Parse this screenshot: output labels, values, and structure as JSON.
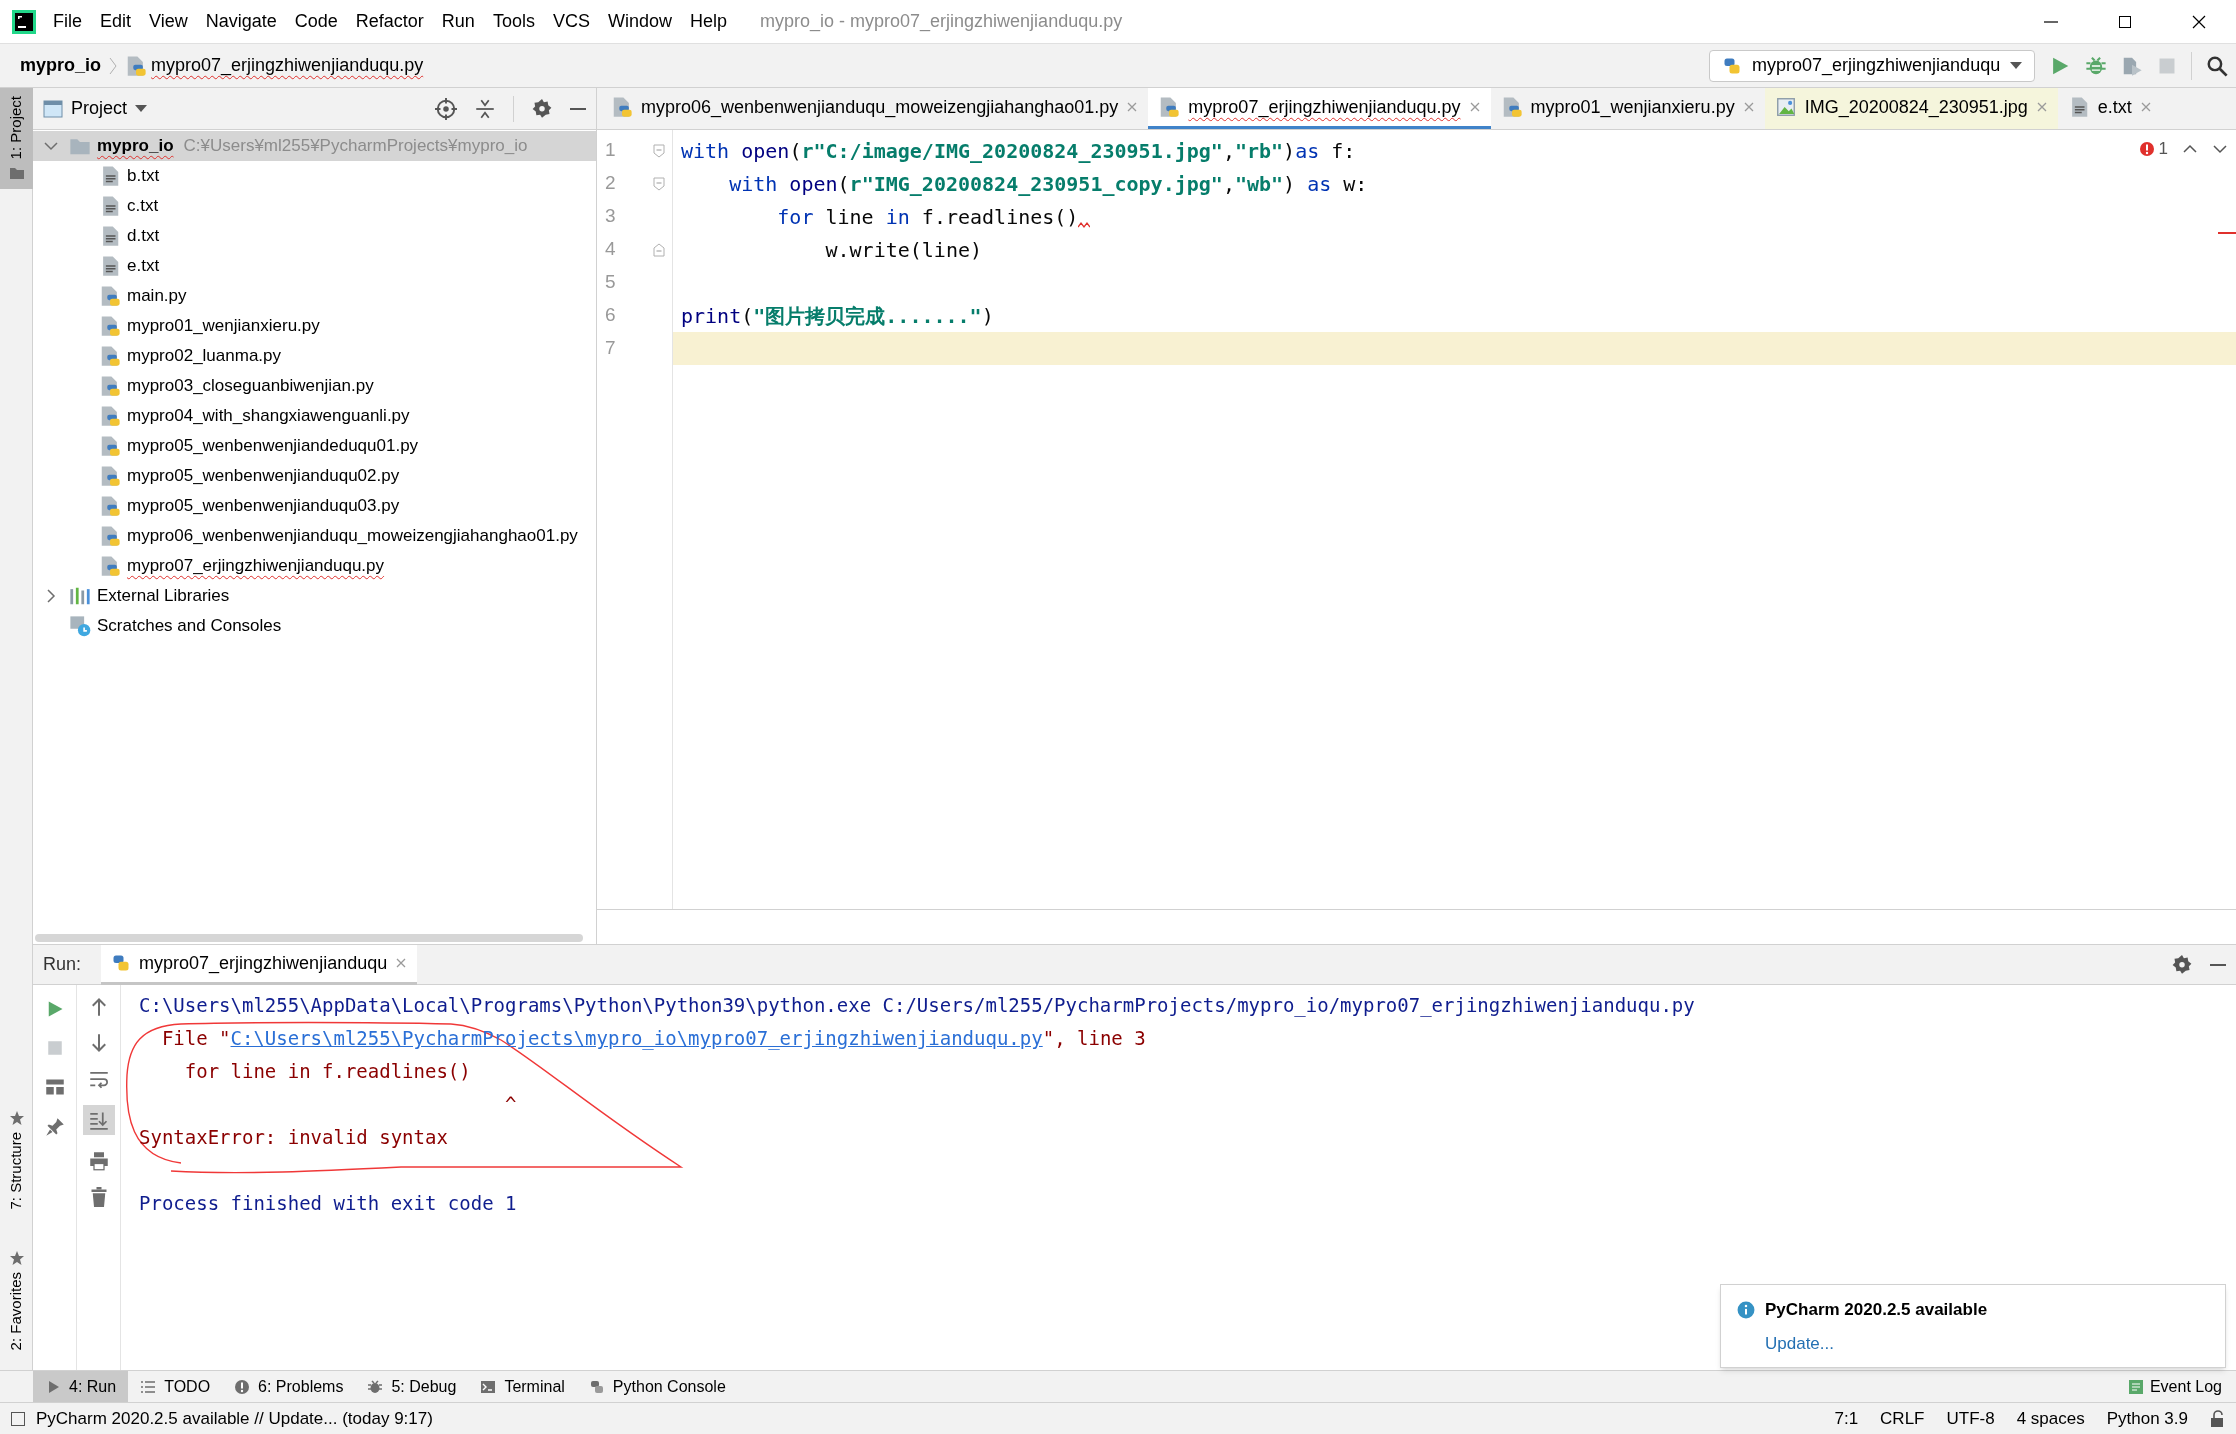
{
  "window": {
    "title": "mypro_io - mypro07_erjingzhiwenjianduqu.py"
  },
  "menu": [
    "File",
    "Edit",
    "View",
    "Navigate",
    "Code",
    "Refactor",
    "Run",
    "Tools",
    "VCS",
    "Window",
    "Help"
  ],
  "navbar": {
    "breadcrumbs": [
      {
        "label": "mypro_io",
        "error": false
      },
      {
        "label": "mypro07_erjingzhiwenjianduqu.py",
        "kind": "python",
        "error": true
      }
    ],
    "run_config": "mypro07_erjingzhiwenjianduqu"
  },
  "left_stripe": [
    {
      "label": "1: Project",
      "selected": true,
      "kind": "top"
    },
    {
      "label": "7: Structure",
      "selected": false,
      "kind": "bottom"
    },
    {
      "label": "2: Favorites",
      "selected": false,
      "kind": "bottom"
    }
  ],
  "project_panel": {
    "title": "Project",
    "tree": [
      {
        "label": "mypro_io",
        "path": "C:¥Users¥ml255¥PycharmProjects¥mypro_io",
        "kind": "folder",
        "expanded": true,
        "selected": true,
        "error": true,
        "children": [
          {
            "label": "b.txt",
            "kind": "text",
            "selected": false,
            "error": false
          },
          {
            "label": "c.txt",
            "kind": "text",
            "selected": false,
            "error": false
          },
          {
            "label": "d.txt",
            "kind": "text",
            "selected": false,
            "error": false
          },
          {
            "label": "e.txt",
            "kind": "text",
            "selected": false,
            "error": false
          },
          {
            "label": "main.py",
            "kind": "python",
            "selected": false,
            "error": false
          },
          {
            "label": "mypro01_wenjianxieru.py",
            "kind": "python",
            "selected": false,
            "error": false
          },
          {
            "label": "mypro02_luanma.py",
            "kind": "python",
            "selected": false,
            "error": false
          },
          {
            "label": "mypro03_closeguanbiwenjian.py",
            "kind": "python",
            "selected": false,
            "error": false
          },
          {
            "label": "mypro04_with_shangxiawenguanli.py",
            "kind": "python",
            "selected": false,
            "error": false
          },
          {
            "label": "mypro05_wenbenwenjiandeduqu01.py",
            "kind": "python",
            "selected": false,
            "error": false
          },
          {
            "label": "mypro05_wenbenwenjianduqu02.py",
            "kind": "python",
            "selected": false,
            "error": false
          },
          {
            "label": "mypro05_wenbenwenjianduqu03.py",
            "kind": "python",
            "selected": false,
            "error": false
          },
          {
            "label": "mypro06_wenbenwenjianduqu_moweizengjiahanghao01.py",
            "kind": "python",
            "selected": false,
            "error": false
          },
          {
            "label": "mypro07_erjingzhiwenjianduqu.py",
            "kind": "python",
            "selected": false,
            "error": true
          }
        ]
      },
      {
        "label": "External Libraries",
        "kind": "library",
        "expanded": false,
        "selected": false,
        "error": false
      },
      {
        "label": "Scratches and Consoles",
        "kind": "scratches",
        "selected": false,
        "error": false
      }
    ]
  },
  "editor_tabs": [
    {
      "label": "mypro06_wenbenwenjianduqu_moweizengjiahanghao01.py",
      "kind": "python",
      "selected": false,
      "error": false
    },
    {
      "label": "mypro07_erjingzhiwenjianduqu.py",
      "kind": "python",
      "selected": true,
      "error": true
    },
    {
      "label": "mypro01_wenjianxieru.py",
      "kind": "python",
      "selected": false,
      "error": false
    },
    {
      "label": "IMG_20200824_230951.jpg",
      "kind": "image",
      "selected": false,
      "error": false
    },
    {
      "label": "e.txt",
      "kind": "text",
      "selected": false,
      "error": false
    }
  ],
  "editor": {
    "problems": "1",
    "lines": [
      {
        "number": "1",
        "kind": "fold_start",
        "current": false,
        "error": false,
        "tokens": [
          {
            "kind": "keyword",
            "text": "with"
          },
          {
            "kind": "builtin",
            "text": " open"
          },
          {
            "kind": "plain",
            "text": "("
          },
          {
            "kind": "string",
            "text": "r\"C:/image/IMG_20200824_230951.jpg\""
          },
          {
            "kind": "plain",
            "text": ","
          },
          {
            "kind": "string",
            "text": "\"rb\""
          },
          {
            "kind": "plain",
            "text": ")"
          },
          {
            "kind": "keyword",
            "text": "as"
          },
          {
            "kind": "plain",
            "text": " f:"
          }
        ]
      },
      {
        "number": "2",
        "kind": "fold_start",
        "current": false,
        "error": false,
        "tokens": [
          {
            "kind": "keyword",
            "text": "    with"
          },
          {
            "kind": "builtin",
            "text": " open"
          },
          {
            "kind": "plain",
            "text": "("
          },
          {
            "kind": "string",
            "text": "r\"IMG_20200824_230951_copy.jpg\""
          },
          {
            "kind": "plain",
            "text": ","
          },
          {
            "kind": "string",
            "text": "\"wb\""
          },
          {
            "kind": "plain",
            "text": ") "
          },
          {
            "kind": "keyword",
            "text": "as"
          },
          {
            "kind": "plain",
            "text": " w:"
          }
        ]
      },
      {
        "number": "3",
        "kind": "plain",
        "current": false,
        "error": true,
        "tokens": [
          {
            "kind": "keyword",
            "text": "        for"
          },
          {
            "kind": "plain",
            "text": " line "
          },
          {
            "kind": "keyword",
            "text": "in"
          },
          {
            "kind": "plain",
            "text": " f.readlines()"
          }
        ]
      },
      {
        "number": "4",
        "kind": "fold_end",
        "current": false,
        "error": false,
        "tokens": [
          {
            "kind": "plain",
            "text": "            w.write(line)"
          }
        ]
      },
      {
        "number": "5",
        "kind": "plain",
        "current": false,
        "error": false
      },
      {
        "number": "6",
        "kind": "plain",
        "current": false,
        "error": false,
        "tokens": [
          {
            "kind": "builtin",
            "text": "print"
          },
          {
            "kind": "plain",
            "text": "("
          },
          {
            "kind": "string",
            "text": "\"图片拷贝完成.......\""
          },
          {
            "kind": "plain",
            "text": ")"
          }
        ]
      },
      {
        "number": "7",
        "kind": "plain",
        "current": true,
        "error": false
      }
    ]
  },
  "run_panel": {
    "label": "Run:",
    "tab": "mypro07_erjingzhiwenjianduqu",
    "console": [
      {
        "kind": "output",
        "segments": [
          {
            "kind": "command",
            "text": "C:\\Users\\ml255\\AppData\\Local\\Programs\\Python\\Python39\\python.exe C:/Users/ml255/PycharmProjects/mypro_io/mypro07_erjingzhiwenjianduqu.py"
          }
        ]
      },
      {
        "kind": "output",
        "segments": [
          {
            "kind": "error",
            "text": "  File \""
          },
          {
            "kind": "link",
            "text": "C:\\Users\\ml255\\PycharmProjects\\mypro_io\\mypro07_erjingzhiwenjianduqu.py"
          },
          {
            "kind": "error",
            "text": "\", line 3"
          }
        ]
      },
      {
        "kind": "output",
        "segments": [
          {
            "kind": "error",
            "text": "    for line in f.readlines()"
          }
        ]
      },
      {
        "kind": "output",
        "segments": [
          {
            "kind": "error",
            "text": "                                ^"
          }
        ]
      },
      {
        "kind": "output",
        "segments": [
          {
            "kind": "error",
            "text": "SyntaxError: invalid syntax"
          }
        ]
      },
      {
        "kind": "after_blank",
        "segments": [
          {
            "kind": "command",
            "text": "Process finished with exit code 1"
          }
        ]
      }
    ]
  },
  "tool_tabs": [
    {
      "label": "4: Run",
      "kind": "run",
      "selected": true
    },
    {
      "label": "TODO",
      "kind": "todo",
      "selected": false
    },
    {
      "label": "6: Problems",
      "kind": "problems",
      "selected": false
    },
    {
      "label": "5: Debug",
      "kind": "debug",
      "selected": false
    },
    {
      "label": "Terminal",
      "kind": "terminal",
      "selected": false
    },
    {
      "label": "Python Console",
      "kind": "python",
      "selected": false
    }
  ],
  "event_log": "Event Log",
  "notification": {
    "title": "PyCharm 2020.2.5 available",
    "action": "Update..."
  },
  "status_bar": {
    "message": "PyCharm 2020.2.5 available // Update... (today 9:17)",
    "items": [
      "7:1",
      "CRLF",
      "UTF-8",
      "4 spaces",
      "Python 3.9"
    ]
  }
}
